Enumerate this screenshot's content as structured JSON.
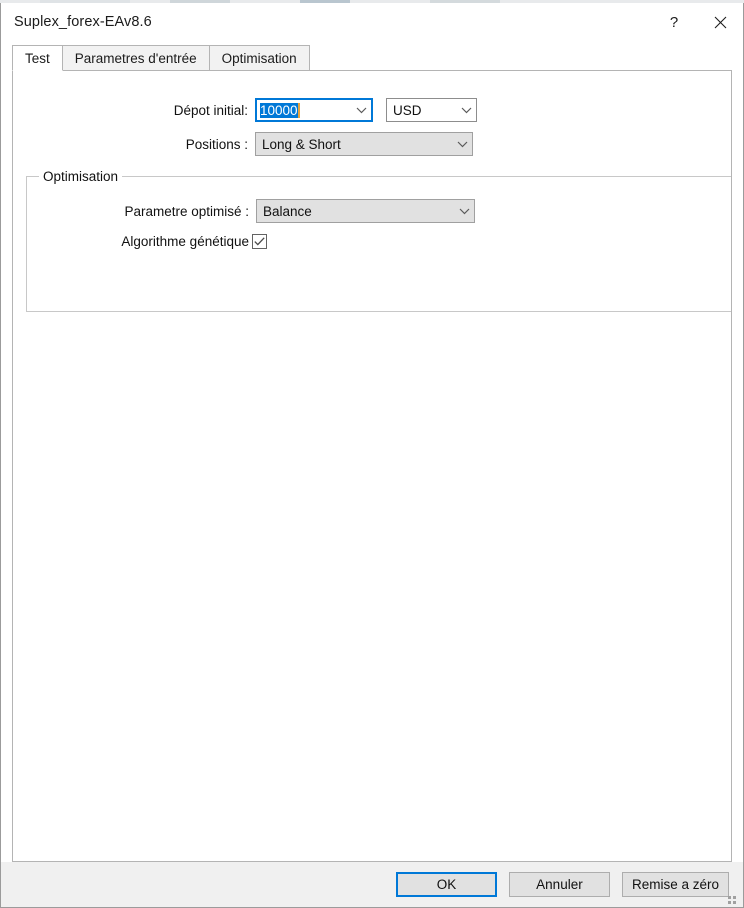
{
  "window": {
    "title": "Suplex_forex-EAv8.6",
    "help_label": "?",
    "close_label": "✕"
  },
  "tabs": [
    {
      "label": "Test",
      "active": true
    },
    {
      "label": "Parametres d'entrée",
      "active": false
    },
    {
      "label": "Optimisation",
      "active": false
    }
  ],
  "form": {
    "deposit": {
      "label": "Dépot initial:",
      "value": "10000",
      "selected": true
    },
    "currency": {
      "label": "",
      "value": "USD"
    },
    "positions": {
      "label": "Positions :",
      "value": "Long & Short"
    }
  },
  "optimisation_group": {
    "title": "Optimisation",
    "parameter": {
      "label": "Parametre optimisé :",
      "value": "Balance"
    },
    "genetic": {
      "label": "Algorithme génétique",
      "checked": true
    }
  },
  "footer": {
    "ok_label": "OK",
    "cancel_label": "Annuler",
    "reset_label": "Remise a zéro"
  },
  "colors": {
    "accent": "#0078d7",
    "window_bg": "#ffffff",
    "footer_bg": "#f0f0f0",
    "control_bg": "#e1e1e1",
    "border": "#b4b4b4",
    "caret": "#e8a33d"
  }
}
